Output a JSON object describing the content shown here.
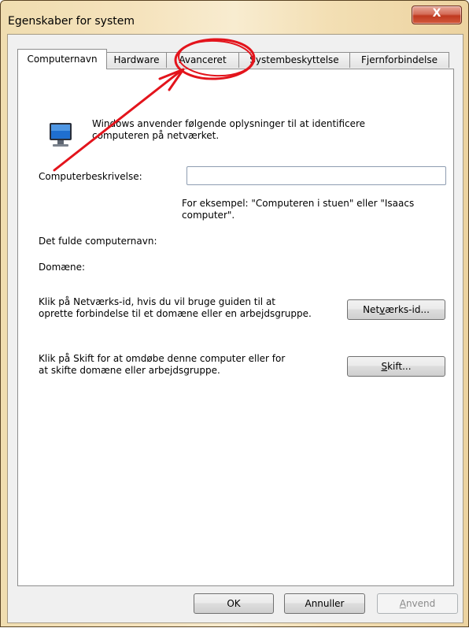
{
  "window": {
    "title": "Egenskaber for system",
    "close_icon": "close-icon",
    "close_glyph": "X"
  },
  "tabs": [
    {
      "label": "Computernavn",
      "active": true
    },
    {
      "label": "Hardware",
      "active": false
    },
    {
      "label": "Avanceret",
      "active": false
    },
    {
      "label": "Systembeskyttelse",
      "active": false
    },
    {
      "label": "Fjernforbindelse",
      "active": false
    }
  ],
  "panel": {
    "icon": "computer-monitor-icon",
    "intro_line1": "Windows anvender følgende oplysninger til at identificere",
    "intro_line2": "computeren på netværket.",
    "description_label": "Computerbeskrivelse:",
    "description_value": "",
    "example_line1": "For eksempel: \"Computeren i stuen\" eller \"Isaacs",
    "example_line2": "computer\".",
    "full_name_label": "Det fulde computernavn:",
    "domain_label": "Domæne:",
    "network_text_line1": "Klik på Netværks-id, hvis du vil bruge guiden til at",
    "network_text_line2": "oprette forbindelse til et domæne eller en arbejdsgruppe.",
    "network_button": {
      "pre": "Net",
      "accel": "v",
      "post": "ærks-id..."
    },
    "change_text_line1": "Klik på Skift for at omdøbe denne computer eller for",
    "change_text_line2": "at skifte domæne eller arbejdsgruppe.",
    "change_button": {
      "pre": "",
      "accel": "S",
      "post": "kift..."
    }
  },
  "buttons": {
    "ok": "OK",
    "cancel": "Annuller",
    "apply": {
      "accel": "A",
      "post": "nvend",
      "enabled": false
    }
  },
  "annotation": {
    "color": "#e3141c",
    "circle_target": "Avanceret",
    "arrow_icon": "red-arrow-annotation"
  },
  "colors": {
    "title_gradient": [
      "#f0ddb0",
      "#ecd3a0"
    ],
    "close_button": "#c0391f",
    "dialog_face": "#f0f0f0",
    "panel_bg": "#ffffff"
  }
}
